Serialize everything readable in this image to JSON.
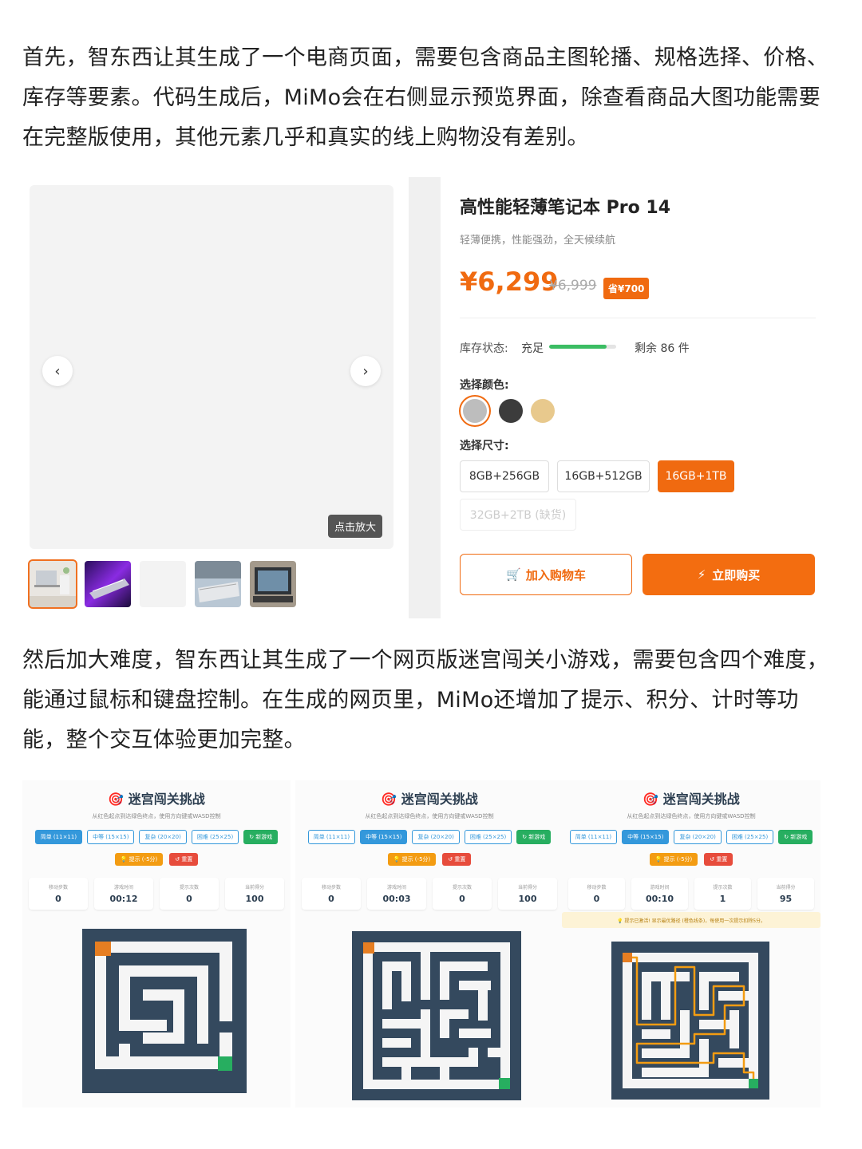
{
  "article": {
    "para1": "首先，智东西让其生成了一个电商页面，需要包含商品主图轮播、规格选择、价格、库存等要素。代码生成后，MiMo会在右侧显示预览界面，除查看商品大图功能需要在完整版使用，其他元素几乎和真实的线上购物没有差别。",
    "para2": "然后加大难度，智东西让其生成了一个网页版迷宫闯关小游戏，需要包含四个难度，能通过鼠标和键盘控制。在生成的网页里，MiMo还增加了提示、积分、计时等功能，整个交互体验更加完整。"
  },
  "product": {
    "title": "高性能轻薄笔记本 Pro 14",
    "subtitle": "轻薄便携，性能强劲，全天候续航",
    "price": "¥6,299",
    "old_price": "¥6,999",
    "save_badge": "省¥700",
    "stock_label": "库存状态:",
    "stock_status": "充足",
    "stock_level_fraction": 0.86,
    "stock_remain": "剩余 86 件",
    "color_label": "选择颜色:",
    "colors": [
      "#bdbdbd",
      "#3c3c3c",
      "#e8c98d"
    ],
    "size_label": "选择尺寸:",
    "sizes": [
      "8GB+256GB",
      "16GB+512GB",
      "16GB+1TB",
      "32GB+2TB (缺货)"
    ],
    "zoom_label": "点击放大",
    "prev_icon": "‹",
    "next_icon": "›",
    "cart_label": "加入购物车",
    "cart_icon": "🛒",
    "buy_label": "立即购买",
    "buy_icon": "⚡",
    "accent_color": "#f06a10"
  },
  "games": [
    {
      "title": "🎯 迷宫闯关挑战",
      "subtitle": "从红色起点到达绿色终点，使用方向键或WASD控制",
      "levels": [
        "简单 (11×11)",
        "中等 (15×15)",
        "复杂 (20×20)",
        "困难 (25×25)"
      ],
      "active_level": 0,
      "new_game": "↻ 新游戏",
      "hint": "💡 提示 (-5分)",
      "reset": "↺ 重置",
      "stats": [
        {
          "label": "移动步数",
          "value": "0"
        },
        {
          "label": "游戏时间",
          "value": "00:12"
        },
        {
          "label": "提示次数",
          "value": "0"
        },
        {
          "label": "当前得分",
          "value": "100"
        }
      ]
    },
    {
      "title": "🎯 迷宫闯关挑战",
      "subtitle": "从红色起点到达绿色终点，使用方向键或WASD控制",
      "levels": [
        "简单 (11×11)",
        "中等 (15×15)",
        "复杂 (20×20)",
        "困难 (25×25)"
      ],
      "active_level": 1,
      "new_game": "↻ 新游戏",
      "hint": "💡 提示 (-5分)",
      "reset": "↺ 重置",
      "stats": [
        {
          "label": "移动步数",
          "value": "0"
        },
        {
          "label": "游戏时间",
          "value": "00:03"
        },
        {
          "label": "提示次数",
          "value": "0"
        },
        {
          "label": "当前得分",
          "value": "100"
        }
      ]
    },
    {
      "title": "🎯 迷宫闯关挑战",
      "subtitle": "从红色起点到达绿色终点，使用方向键或WASD控制",
      "levels": [
        "简单 (11×11)",
        "中等 (15×15)",
        "复杂 (20×20)",
        "困难 (25×25)"
      ],
      "active_level": 1,
      "new_game": "↻ 新游戏",
      "hint": "💡 提示 (-5分)",
      "reset": "↺ 重置",
      "stats": [
        {
          "label": "移动步数",
          "value": "0"
        },
        {
          "label": "游戏时间",
          "value": "00:10"
        },
        {
          "label": "提示次数",
          "value": "1"
        },
        {
          "label": "当前得分",
          "value": "95"
        }
      ],
      "banner": "💡 提示已激活! 显示最优路径 (橙色线条)，每使用一次提示扣除5分。"
    }
  ]
}
